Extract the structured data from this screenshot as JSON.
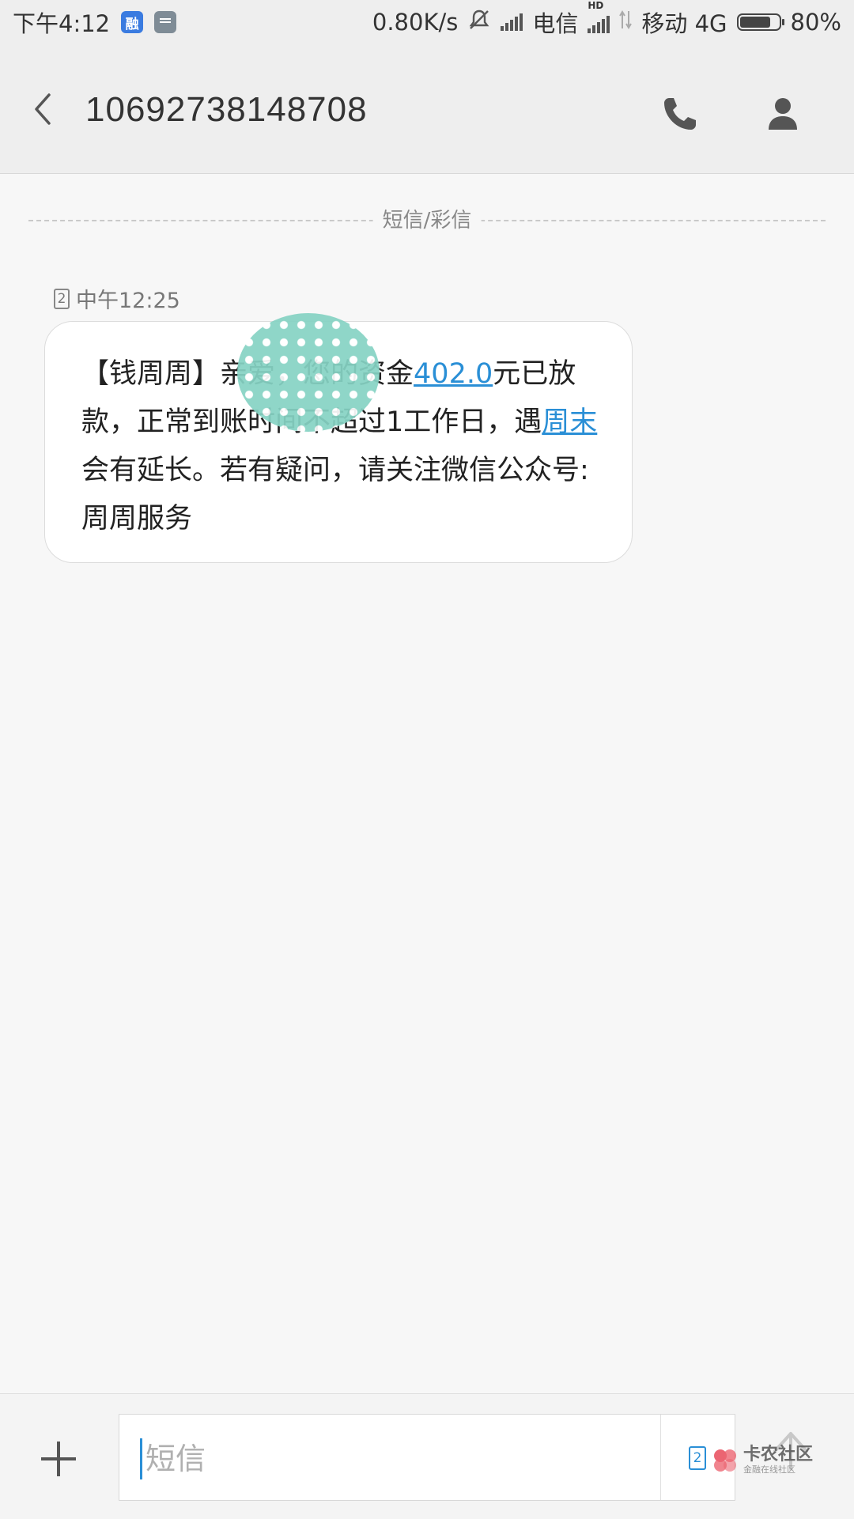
{
  "status_bar": {
    "time": "下午4:12",
    "app_icon_1": "融",
    "net_speed": "0.80K/s",
    "carrier_1": "电信",
    "hd_label": "HD",
    "carrier_2": "移动 4G",
    "battery": "80%",
    "battery_level": 0.8,
    "icons": [
      "rong-app-icon",
      "message-app-icon",
      "mute-icon",
      "signal-icon",
      "hd-signal-icon",
      "data-arrows-icon",
      "battery-icon"
    ]
  },
  "header": {
    "title": "10692738148708",
    "icons": [
      "back-icon",
      "phone-icon",
      "contact-icon"
    ]
  },
  "thread": {
    "divider_label": "短信/彩信",
    "message": {
      "sim": "2",
      "time": "中午12:25",
      "text_parts": [
        "【钱周周】亲爱",
        "，您的资金",
        "402.0",
        "元已放款，正常到账时间不超过1工作日，遇",
        "周末",
        "会有延长。若有疑问，请关注微信公众号:周周服务"
      ]
    }
  },
  "composer": {
    "placeholder": "短信",
    "sim": "2",
    "icons": [
      "add-icon",
      "send-icon"
    ]
  },
  "watermark": {
    "title": "卡农社区",
    "subtitle": "金融在线社区"
  },
  "colors": {
    "link": "#2a8fd6",
    "background": "#f7f7f7",
    "header": "#eeeeee"
  }
}
